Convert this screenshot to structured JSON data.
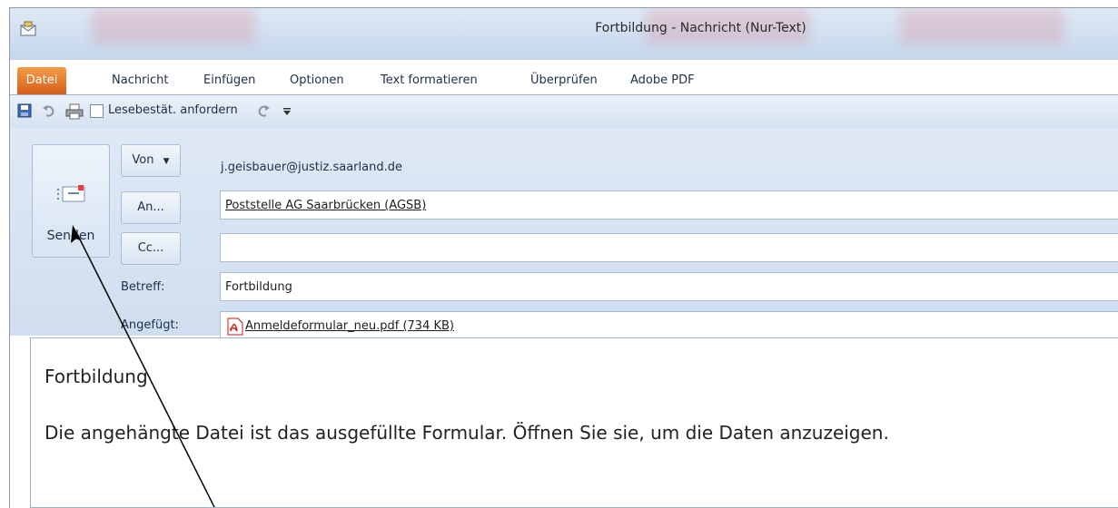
{
  "window": {
    "title": "Fortbildung - Nachricht (Nur-Text)"
  },
  "ribbon": {
    "tabs": [
      "Datei",
      "Nachricht",
      "Einfügen",
      "Optionen",
      "Text formatieren",
      "Überprüfen",
      "Adobe PDF"
    ]
  },
  "quick_access": {
    "read_receipt_label": "Lesebestät. anfordern",
    "icons": [
      "save-icon",
      "undo-icon",
      "print-icon",
      "redo-icon",
      "customize-dropdown-icon"
    ]
  },
  "compose": {
    "send_label": "Senden",
    "from_label": "Von",
    "from_value": "j.geisbauer@justiz.saarland.de",
    "to_label": "An...",
    "to_value": "Poststelle AG Saarbrücken (AGSB)",
    "cc_label": "Cc...",
    "cc_value": "",
    "subject_label": "Betreff:",
    "subject_value": "Fortbildung",
    "attached_label": "Angefügt:",
    "attachment": "Anmeldeformular_neu.pdf (734 KB)"
  },
  "message": {
    "line1": "Fortbildung",
    "line2": "Die angehängte Datei ist das ausgefüllte Formular. Öffnen Sie sie, um die Daten anzuzeigen."
  },
  "colors": {
    "file_tab": "#e7772a",
    "ribbon_bg": "#d6e2f1",
    "accent_text": "#1e2f4a"
  }
}
